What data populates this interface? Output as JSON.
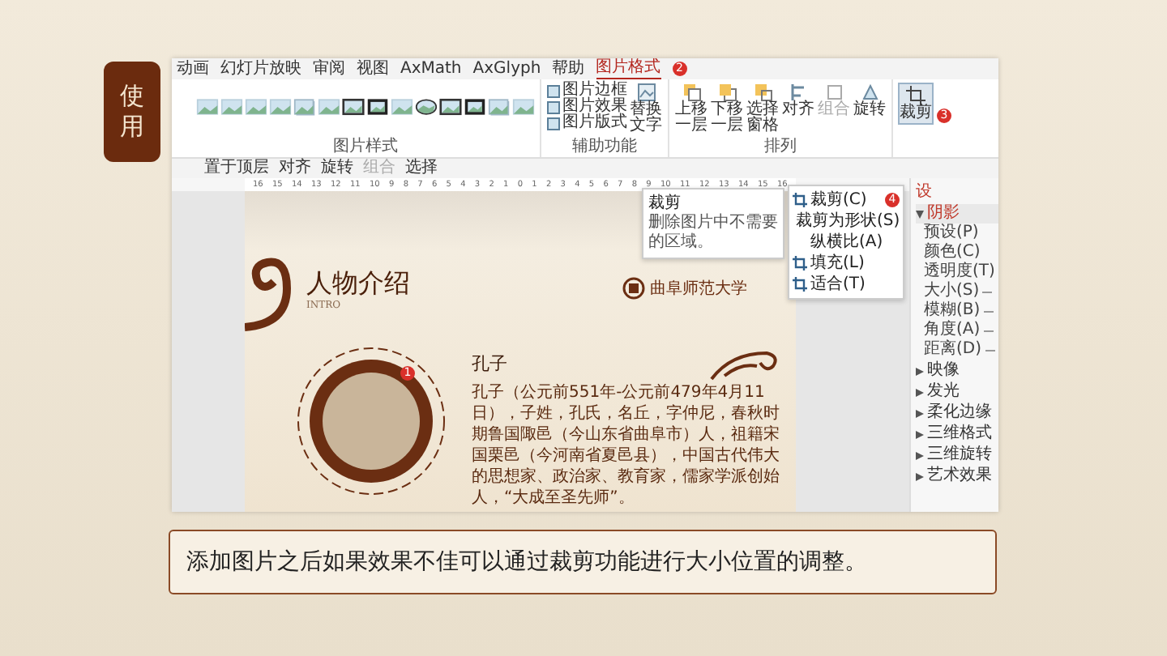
{
  "side_label": "使用",
  "ribbon": {
    "tabs": [
      {
        "label": "动画",
        "selected": false
      },
      {
        "label": "幻灯片放映",
        "selected": false
      },
      {
        "label": "审阅",
        "selected": false
      },
      {
        "label": "视图",
        "selected": false
      },
      {
        "label": "AxMath",
        "selected": false
      },
      {
        "label": "AxGlyph",
        "selected": false
      },
      {
        "label": "帮助",
        "selected": false
      },
      {
        "label": "图片格式",
        "selected": true,
        "badge": "2"
      }
    ],
    "picture_styles": [
      {
        "kind": "soft"
      },
      {
        "kind": "soft"
      },
      {
        "kind": "soft"
      },
      {
        "kind": "soft"
      },
      {
        "kind": "shadow"
      },
      {
        "kind": "soft"
      },
      {
        "kind": "dark"
      },
      {
        "kind": "frame"
      },
      {
        "kind": "soft"
      },
      {
        "kind": "oval"
      },
      {
        "kind": "dark"
      },
      {
        "kind": "frame"
      },
      {
        "kind": "shadow"
      },
      {
        "kind": "soft"
      }
    ],
    "style_group_label": "图片样式",
    "picture_options": [
      "图片边框",
      "图片效果",
      "图片版式"
    ],
    "alt_text": "替换文字",
    "accessibility_label": "辅助功能",
    "arrange_buttons": [
      {
        "label": "上移一层",
        "disabled": false
      },
      {
        "label": "下移一层",
        "disabled": false
      },
      {
        "label": "选择窗格",
        "disabled": false
      },
      {
        "label": "对齐",
        "disabled": false
      },
      {
        "label": "组合",
        "disabled": true
      },
      {
        "label": "旋转",
        "disabled": false
      }
    ],
    "arrange_label": "排列",
    "crop_button": {
      "label": "裁剪",
      "badge": "3"
    }
  },
  "crop_menu": [
    {
      "label": "裁剪(C)",
      "kind": "tool",
      "badge": "4"
    },
    {
      "label": "裁剪为形状(S)",
      "kind": "tool"
    },
    {
      "label": "纵横比(A)",
      "kind": "submenu"
    },
    {
      "label": "填充(L)",
      "kind": "tool"
    },
    {
      "label": "适合(T)",
      "kind": "tool"
    }
  ],
  "tooltip": {
    "title": "裁剪",
    "text": "删除图片中不需要的区域。"
  },
  "quick_bar": [
    {
      "label": "置于顶层",
      "disabled": false
    },
    {
      "label": "对齐",
      "disabled": false
    },
    {
      "label": "旋转",
      "disabled": false
    },
    {
      "label": "组合",
      "disabled": true
    },
    {
      "label": "选择",
      "disabled": false
    }
  ],
  "ruler": [
    "16",
    "15",
    "14",
    "13",
    "12",
    "11",
    "10",
    "9",
    "8",
    "7",
    "6",
    "5",
    "4",
    "3",
    "2",
    "1",
    "0",
    "1",
    "2",
    "3",
    "4",
    "5",
    "6",
    "7",
    "8",
    "9",
    "10",
    "11",
    "12",
    "13",
    "14",
    "15",
    "16"
  ],
  "slide": {
    "title": "人物介绍",
    "subtitle": "INTRO",
    "logo_text": "曲阜师范大学",
    "name": "孔子",
    "photo_badge": "1",
    "bio": "孔子（公元前551年-公元前479年4月11日），子姓，孔氏，名丘，字仲尼，春秋时期鲁国陬邑（今山东省曲阜市）人，祖籍宋国栗邑（今河南省夏邑县），中国古代伟大的思想家、政治家、教育家，儒家学派创始人，“大成至圣先师”。"
  },
  "format_pane": {
    "title": "设",
    "sections": [
      {
        "label": "阴影",
        "expanded": true,
        "fields": [
          {
            "label": "预设(P)",
            "kind": "select"
          },
          {
            "label": "颜色(C)",
            "kind": "select"
          },
          {
            "label": "透明度(T)",
            "kind": "slider"
          },
          {
            "label": "大小(S)",
            "kind": "slider"
          },
          {
            "label": "模糊(B)",
            "kind": "slider"
          },
          {
            "label": "角度(A)",
            "kind": "slider"
          },
          {
            "label": "距离(D)",
            "kind": "slider"
          }
        ]
      },
      {
        "label": "映像",
        "expanded": false
      },
      {
        "label": "发光",
        "expanded": false
      },
      {
        "label": "柔化边缘",
        "expanded": false
      },
      {
        "label": "三维格式",
        "expanded": false
      },
      {
        "label": "三维旋转",
        "expanded": false
      },
      {
        "label": "艺术效果",
        "expanded": false
      }
    ]
  },
  "caption": "添加图片之后如果效果不佳可以通过裁剪功能进行大小位置的调整。"
}
